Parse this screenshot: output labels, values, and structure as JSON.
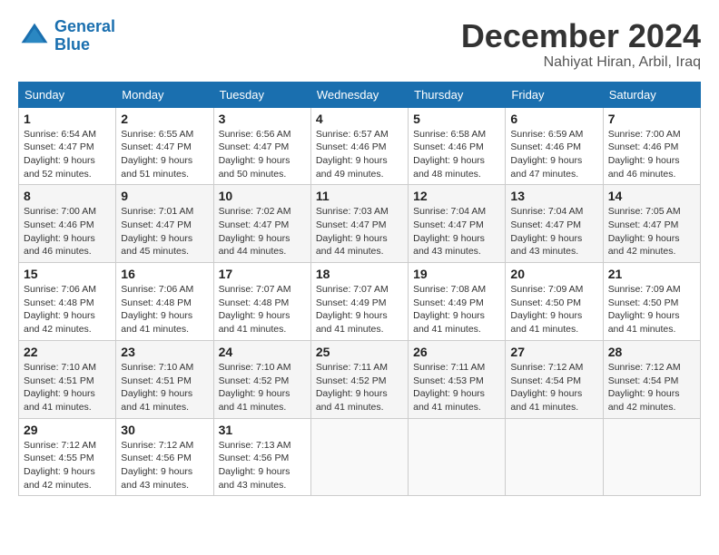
{
  "header": {
    "logo_line1": "General",
    "logo_line2": "Blue",
    "month": "December 2024",
    "location": "Nahiyat Hiran, Arbil, Iraq"
  },
  "weekdays": [
    "Sunday",
    "Monday",
    "Tuesday",
    "Wednesday",
    "Thursday",
    "Friday",
    "Saturday"
  ],
  "weeks": [
    [
      {
        "day": "1",
        "sunrise": "6:54 AM",
        "sunset": "4:47 PM",
        "daylight": "9 hours and 52 minutes."
      },
      {
        "day": "2",
        "sunrise": "6:55 AM",
        "sunset": "4:47 PM",
        "daylight": "9 hours and 51 minutes."
      },
      {
        "day": "3",
        "sunrise": "6:56 AM",
        "sunset": "4:47 PM",
        "daylight": "9 hours and 50 minutes."
      },
      {
        "day": "4",
        "sunrise": "6:57 AM",
        "sunset": "4:46 PM",
        "daylight": "9 hours and 49 minutes."
      },
      {
        "day": "5",
        "sunrise": "6:58 AM",
        "sunset": "4:46 PM",
        "daylight": "9 hours and 48 minutes."
      },
      {
        "day": "6",
        "sunrise": "6:59 AM",
        "sunset": "4:46 PM",
        "daylight": "9 hours and 47 minutes."
      },
      {
        "day": "7",
        "sunrise": "7:00 AM",
        "sunset": "4:46 PM",
        "daylight": "9 hours and 46 minutes."
      }
    ],
    [
      {
        "day": "8",
        "sunrise": "7:00 AM",
        "sunset": "4:46 PM",
        "daylight": "9 hours and 46 minutes."
      },
      {
        "day": "9",
        "sunrise": "7:01 AM",
        "sunset": "4:47 PM",
        "daylight": "9 hours and 45 minutes."
      },
      {
        "day": "10",
        "sunrise": "7:02 AM",
        "sunset": "4:47 PM",
        "daylight": "9 hours and 44 minutes."
      },
      {
        "day": "11",
        "sunrise": "7:03 AM",
        "sunset": "4:47 PM",
        "daylight": "9 hours and 44 minutes."
      },
      {
        "day": "12",
        "sunrise": "7:04 AM",
        "sunset": "4:47 PM",
        "daylight": "9 hours and 43 minutes."
      },
      {
        "day": "13",
        "sunrise": "7:04 AM",
        "sunset": "4:47 PM",
        "daylight": "9 hours and 43 minutes."
      },
      {
        "day": "14",
        "sunrise": "7:05 AM",
        "sunset": "4:47 PM",
        "daylight": "9 hours and 42 minutes."
      }
    ],
    [
      {
        "day": "15",
        "sunrise": "7:06 AM",
        "sunset": "4:48 PM",
        "daylight": "9 hours and 42 minutes."
      },
      {
        "day": "16",
        "sunrise": "7:06 AM",
        "sunset": "4:48 PM",
        "daylight": "9 hours and 41 minutes."
      },
      {
        "day": "17",
        "sunrise": "7:07 AM",
        "sunset": "4:48 PM",
        "daylight": "9 hours and 41 minutes."
      },
      {
        "day": "18",
        "sunrise": "7:07 AM",
        "sunset": "4:49 PM",
        "daylight": "9 hours and 41 minutes."
      },
      {
        "day": "19",
        "sunrise": "7:08 AM",
        "sunset": "4:49 PM",
        "daylight": "9 hours and 41 minutes."
      },
      {
        "day": "20",
        "sunrise": "7:09 AM",
        "sunset": "4:50 PM",
        "daylight": "9 hours and 41 minutes."
      },
      {
        "day": "21",
        "sunrise": "7:09 AM",
        "sunset": "4:50 PM",
        "daylight": "9 hours and 41 minutes."
      }
    ],
    [
      {
        "day": "22",
        "sunrise": "7:10 AM",
        "sunset": "4:51 PM",
        "daylight": "9 hours and 41 minutes."
      },
      {
        "day": "23",
        "sunrise": "7:10 AM",
        "sunset": "4:51 PM",
        "daylight": "9 hours and 41 minutes."
      },
      {
        "day": "24",
        "sunrise": "7:10 AM",
        "sunset": "4:52 PM",
        "daylight": "9 hours and 41 minutes."
      },
      {
        "day": "25",
        "sunrise": "7:11 AM",
        "sunset": "4:52 PM",
        "daylight": "9 hours and 41 minutes."
      },
      {
        "day": "26",
        "sunrise": "7:11 AM",
        "sunset": "4:53 PM",
        "daylight": "9 hours and 41 minutes."
      },
      {
        "day": "27",
        "sunrise": "7:12 AM",
        "sunset": "4:54 PM",
        "daylight": "9 hours and 41 minutes."
      },
      {
        "day": "28",
        "sunrise": "7:12 AM",
        "sunset": "4:54 PM",
        "daylight": "9 hours and 42 minutes."
      }
    ],
    [
      {
        "day": "29",
        "sunrise": "7:12 AM",
        "sunset": "4:55 PM",
        "daylight": "9 hours and 42 minutes."
      },
      {
        "day": "30",
        "sunrise": "7:12 AM",
        "sunset": "4:56 PM",
        "daylight": "9 hours and 43 minutes."
      },
      {
        "day": "31",
        "sunrise": "7:13 AM",
        "sunset": "4:56 PM",
        "daylight": "9 hours and 43 minutes."
      },
      null,
      null,
      null,
      null
    ]
  ]
}
